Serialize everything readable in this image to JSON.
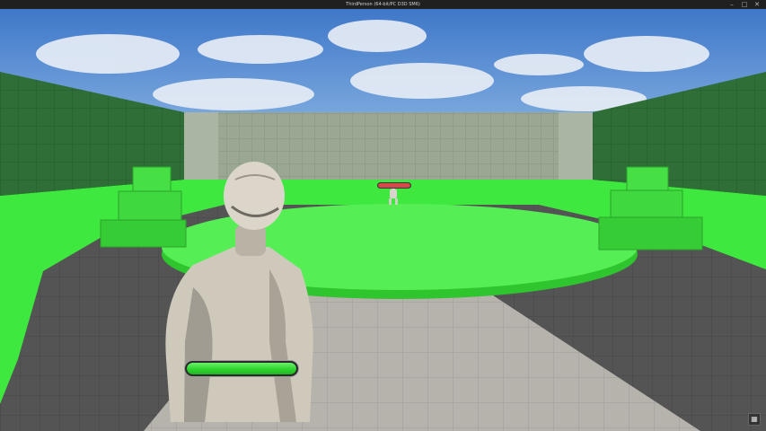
{
  "window": {
    "title": "ThirdPerson (64-bit/PC D3D SM6)",
    "controls": {
      "minimize": "–",
      "maximize": "□",
      "close": "✕"
    }
  },
  "hud": {
    "player_health": {
      "fraction": 1.0,
      "color": "#2fd62f"
    },
    "enemy_health": {
      "fraction": 1.0,
      "color": "#d84a4a"
    }
  },
  "icons": {
    "corner_icon": "grid-icon",
    "corner_glyph": "▦"
  },
  "colors": {
    "sky": "#5c8fd6",
    "wall": "#2f7a3a",
    "arena_green": "#4cf04c",
    "floor_dark": "#5a5a5a",
    "floor_light": "#b8b6b0"
  }
}
